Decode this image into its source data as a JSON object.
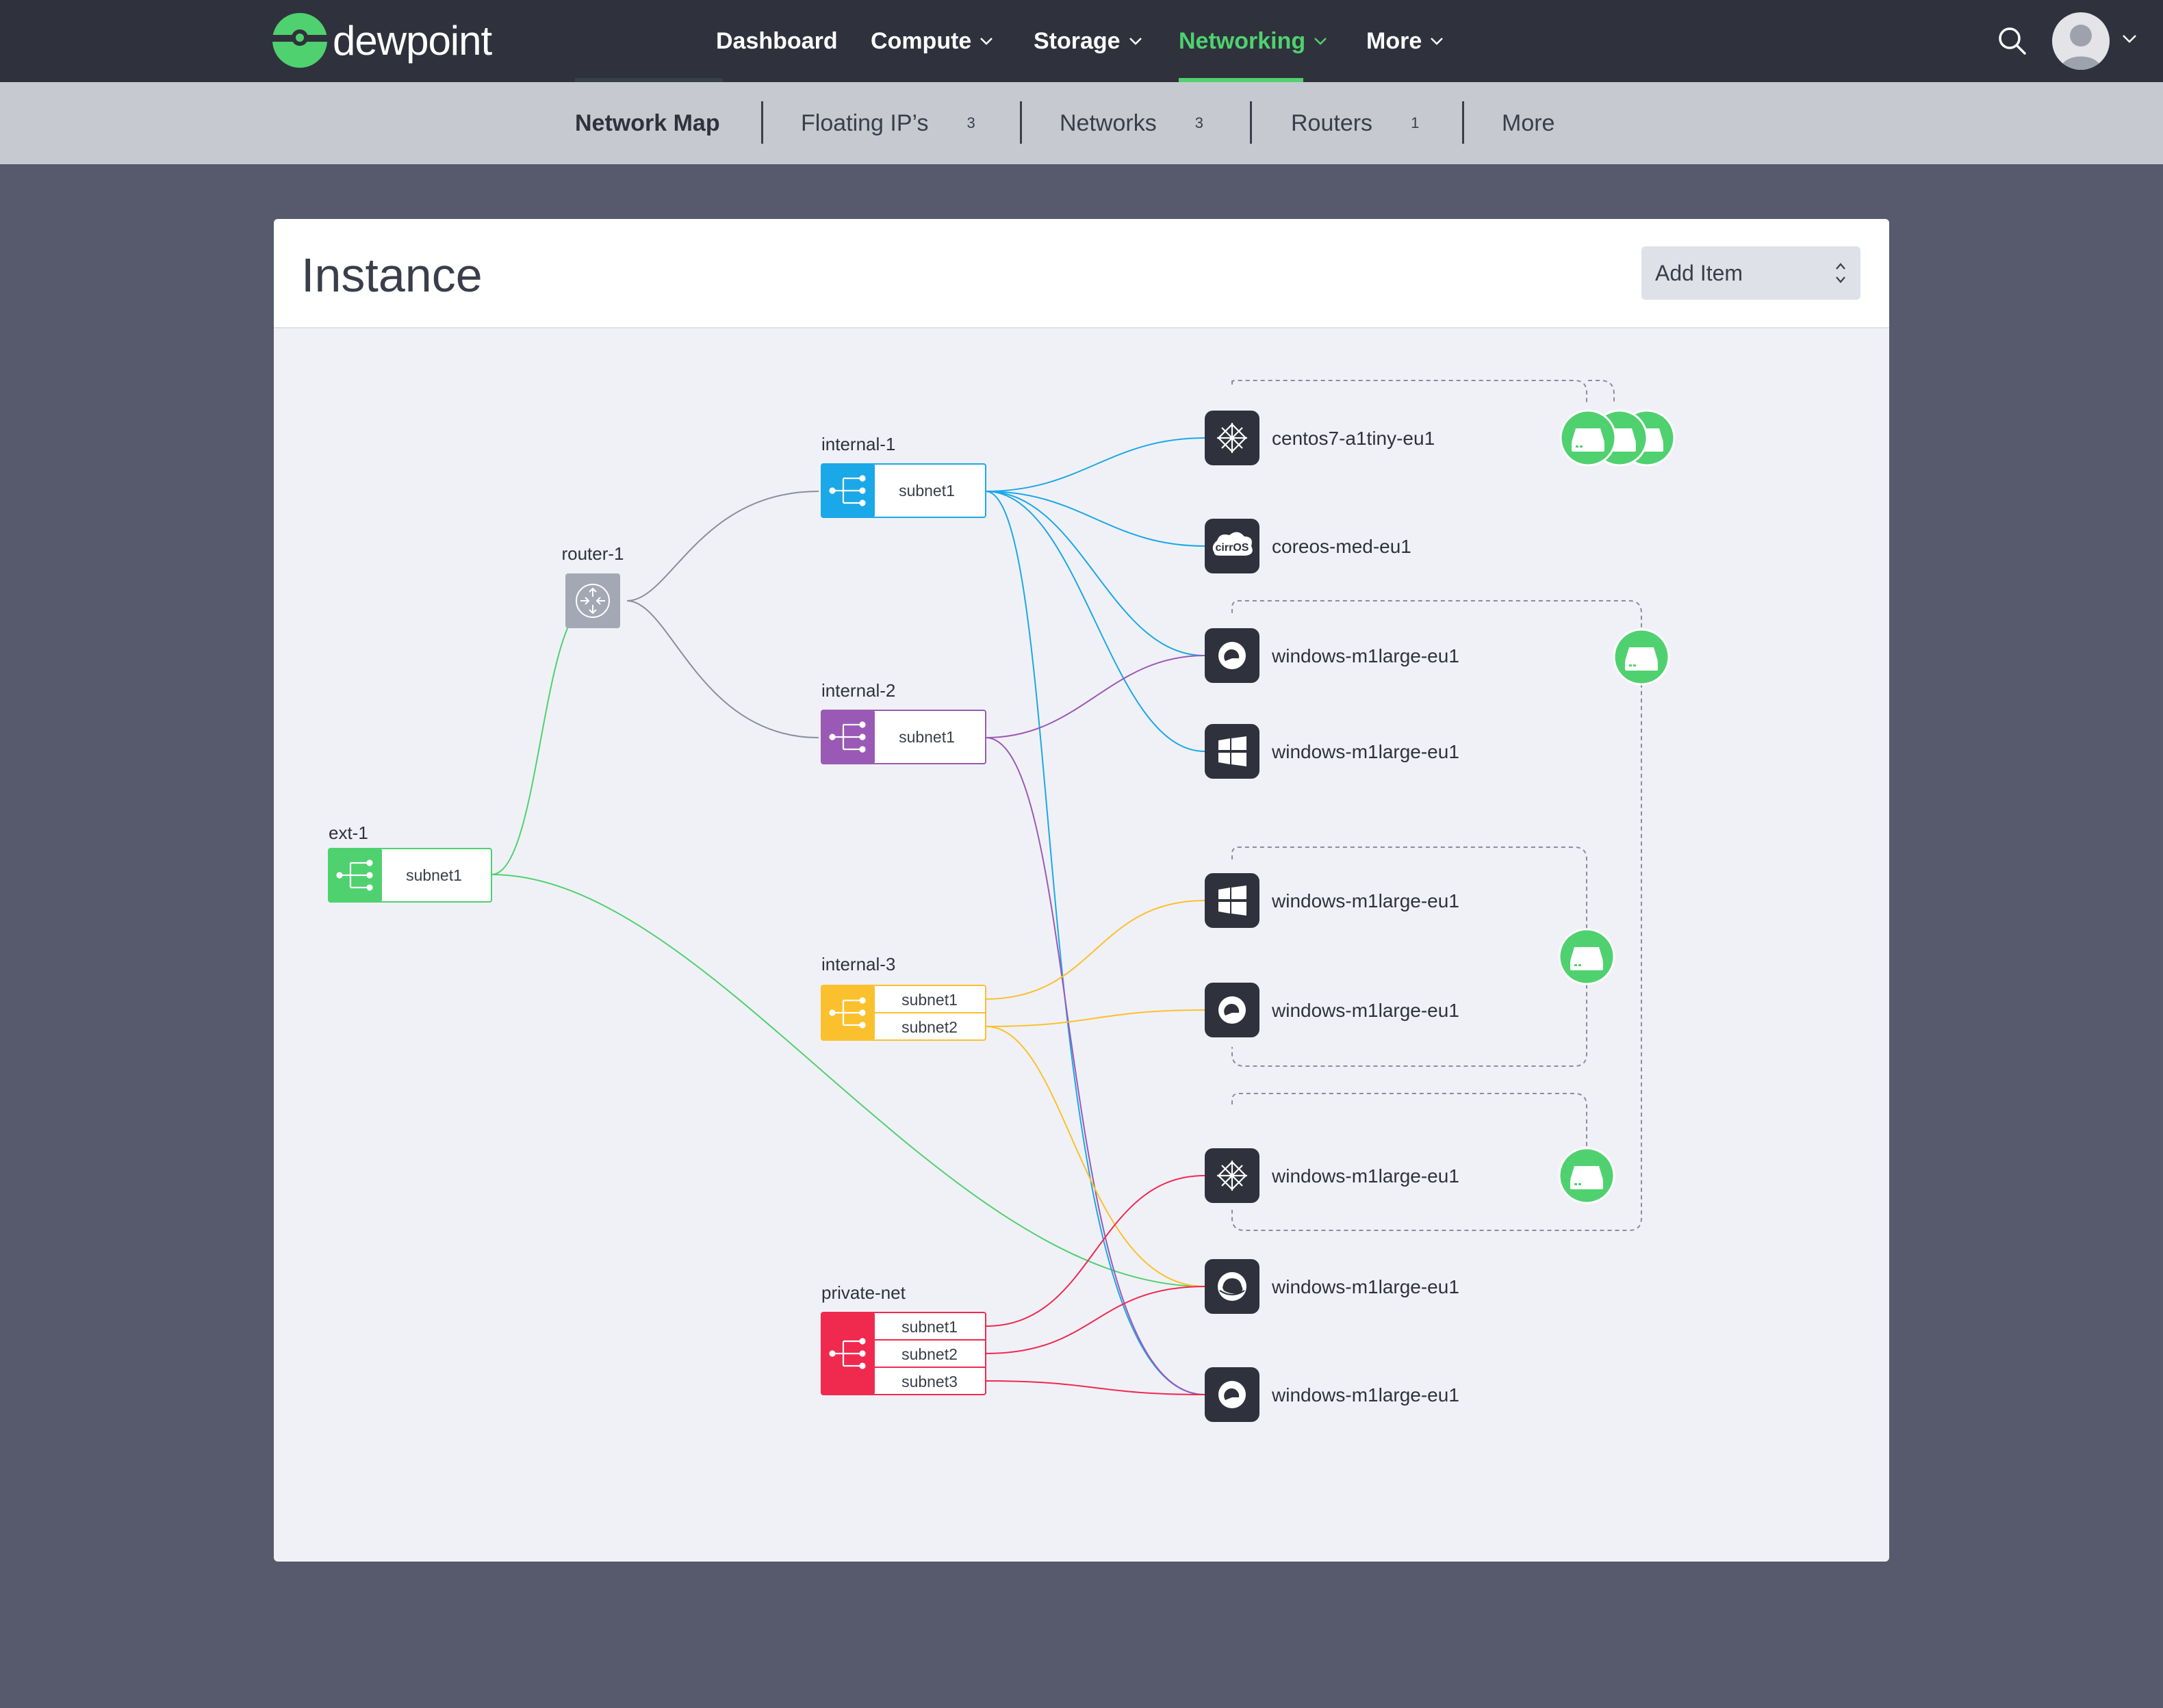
{
  "brand": {
    "name": "dewpoint"
  },
  "nav": {
    "items": [
      {
        "label": "Dashboard"
      },
      {
        "label": "Compute"
      },
      {
        "label": "Storage"
      },
      {
        "label": "Networking"
      },
      {
        "label": "More"
      }
    ],
    "active": "Networking"
  },
  "subnav": {
    "tabs": [
      {
        "label": "Network Map",
        "count": ""
      },
      {
        "label": "Floating IP’s",
        "count": "3"
      },
      {
        "label": "Networks",
        "count": "3"
      },
      {
        "label": "Routers",
        "count": "1"
      },
      {
        "label": "More",
        "count": ""
      }
    ],
    "active": "Network Map"
  },
  "card": {
    "title": "Instance",
    "select": {
      "label": "Add Item"
    }
  },
  "map": {
    "networks": [
      {
        "name": "ext-1",
        "color": "#4fd16f",
        "subnets": [
          "subnet1"
        ]
      },
      {
        "name": "internal-1",
        "color": "#1ba8e8",
        "subnets": [
          "subnet1"
        ]
      },
      {
        "name": "internal-2",
        "color": "#9b59b6",
        "subnets": [
          "subnet1"
        ]
      },
      {
        "name": "internal-3",
        "color": "#fbc02d",
        "subnets": [
          "subnet1",
          "subnet2"
        ]
      },
      {
        "name": "private-net",
        "color": "#f0294f",
        "subnets": [
          "subnet1",
          "subnet2",
          "subnet3"
        ]
      }
    ],
    "router": {
      "name": "router-1",
      "color": "#a4a8b4"
    },
    "instances": [
      {
        "name": "centos7-a1tiny-eu1",
        "icon": "centos-icon"
      },
      {
        "name": "coreos-med-eu1",
        "icon": "cirros-icon"
      },
      {
        "name": "windows-m1large-eu1",
        "icon": "debian-icon"
      },
      {
        "name": "windows-m1large-eu1",
        "icon": "windows-icon"
      },
      {
        "name": "windows-m1large-eu1",
        "icon": "windows-icon"
      },
      {
        "name": "windows-m1large-eu1",
        "icon": "debian-icon"
      },
      {
        "name": "windows-m1large-eu1",
        "icon": "centos-icon"
      },
      {
        "name": "windows-m1large-eu1",
        "icon": "redhat-icon"
      },
      {
        "name": "windows-m1large-eu1",
        "icon": "debian-icon"
      }
    ],
    "cirros_glyph": "cirrOS",
    "volume_icon": "hard-drive-icon",
    "volume_color": "#4fd16f"
  }
}
